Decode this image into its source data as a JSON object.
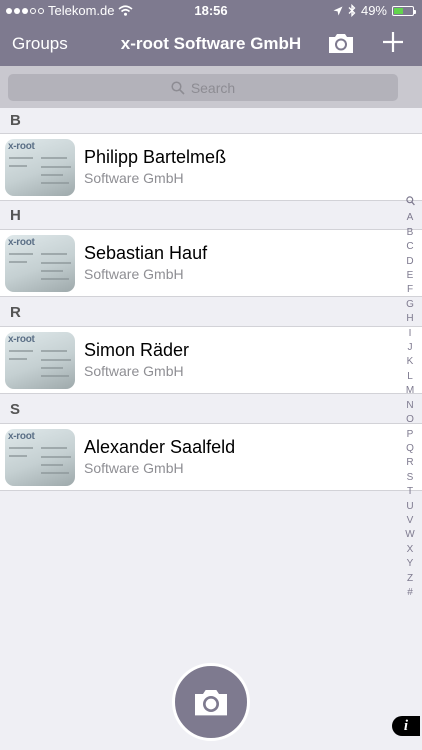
{
  "status_bar": {
    "carrier": "Telekom.de",
    "time": "18:56",
    "battery": "49%",
    "battery_level": 0.49,
    "battery_color": "#62d44d"
  },
  "nav": {
    "left_label": "Groups",
    "title": "x-root Software GmbH",
    "icons": [
      "camera-icon",
      "plus-icon"
    ]
  },
  "search": {
    "placeholder": "Search"
  },
  "theme": {
    "accent": "#7e7a8f",
    "background": "#efeff4",
    "search_bar": "#c9c8cf"
  },
  "sections": [
    {
      "letter": "B",
      "contacts": [
        {
          "name": "Philipp Bartelmeß",
          "company": "Software GmbH"
        }
      ]
    },
    {
      "letter": "H",
      "contacts": [
        {
          "name": "Sebastian Hauf",
          "company": "Software GmbH"
        }
      ]
    },
    {
      "letter": "R",
      "contacts": [
        {
          "name": "Simon Räder",
          "company": "Software GmbH"
        }
      ]
    },
    {
      "letter": "S",
      "contacts": [
        {
          "name": "Alexander Saalfeld",
          "company": "Software GmbH"
        }
      ]
    }
  ],
  "card_logo_text": "x-root",
  "index": [
    "A",
    "B",
    "C",
    "D",
    "E",
    "F",
    "G",
    "H",
    "I",
    "J",
    "K",
    "L",
    "M",
    "N",
    "O",
    "P",
    "Q",
    "R",
    "S",
    "T",
    "U",
    "V",
    "W",
    "X",
    "Y",
    "Z",
    "#"
  ],
  "index_icon": "search-icon",
  "bottom": {
    "fab_icon": "camera-icon",
    "info_label": "i"
  }
}
